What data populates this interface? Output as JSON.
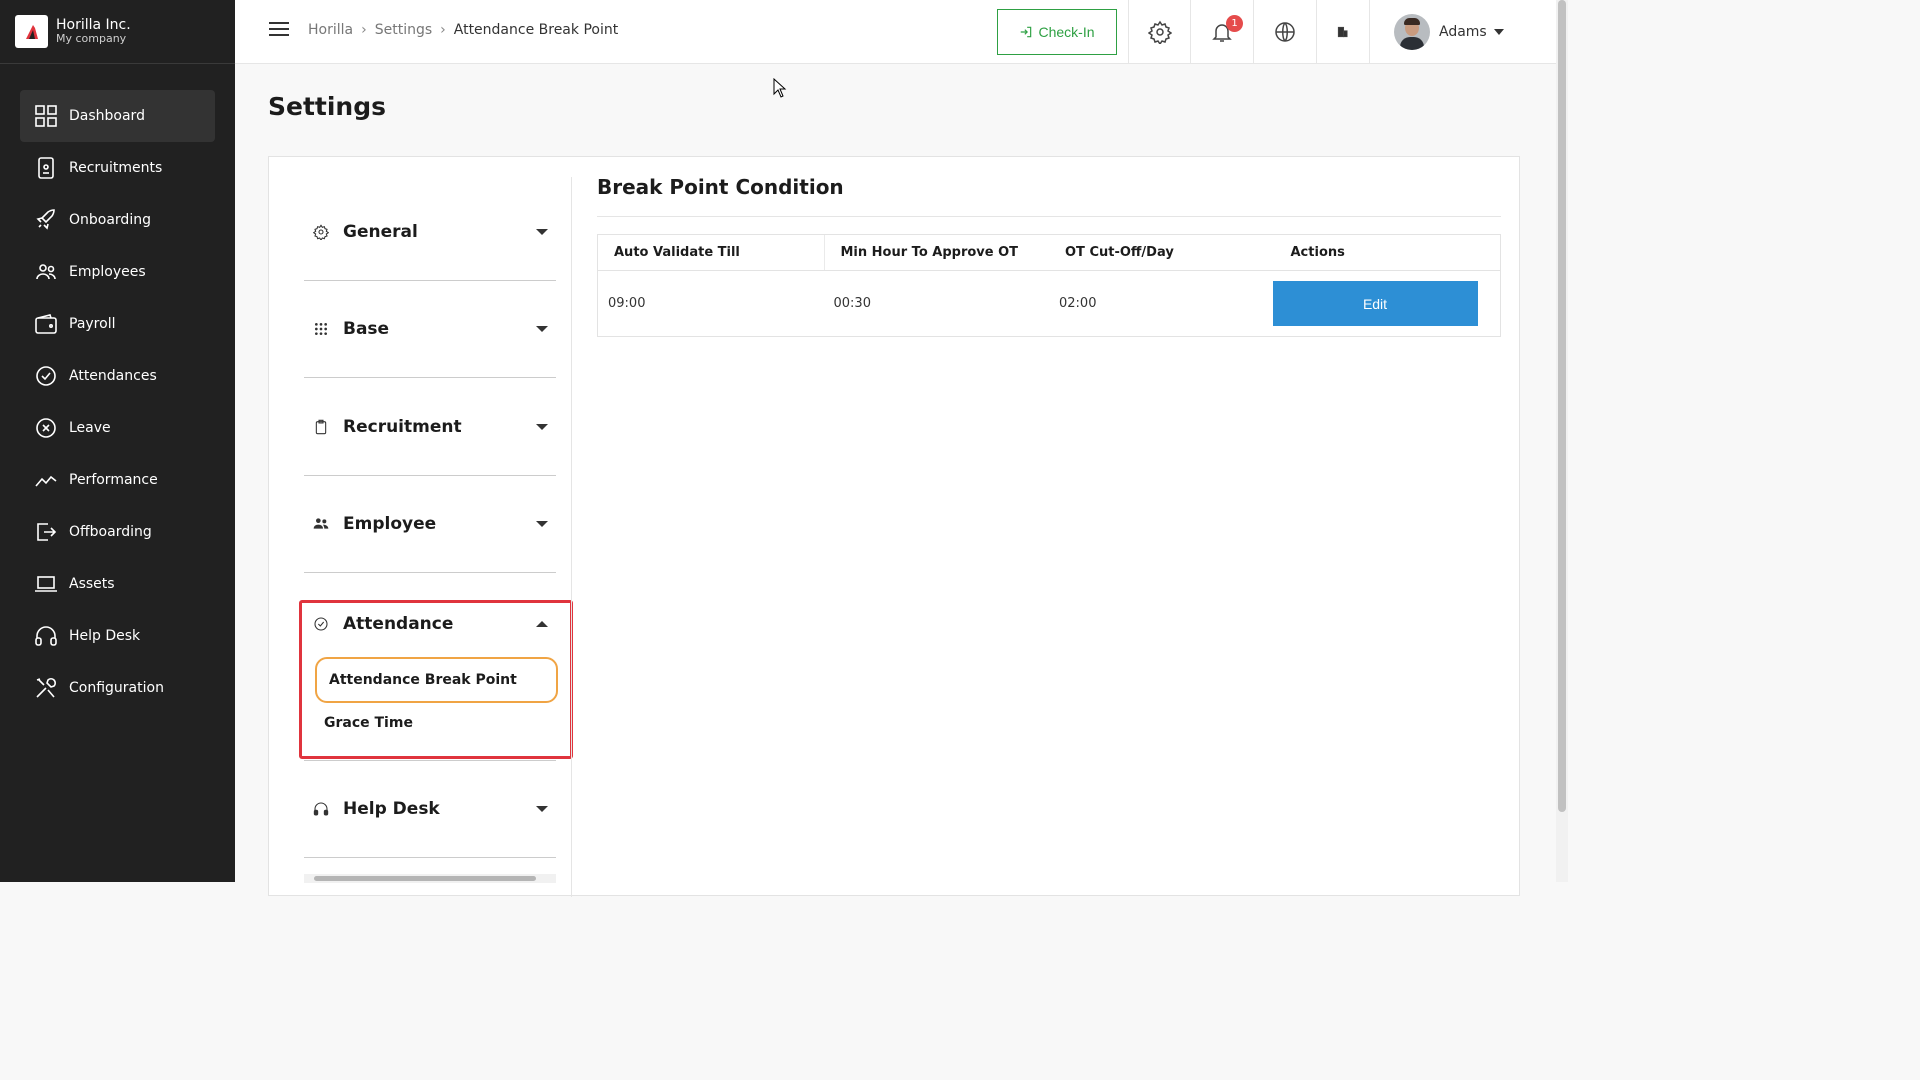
{
  "brand": {
    "name": "Horilla Inc.",
    "subtitle": "My company"
  },
  "sidebar": {
    "items": [
      {
        "label": "Dashboard",
        "icon": "dashboard-icon",
        "active": true
      },
      {
        "label": "Recruitments",
        "icon": "recruitment-icon"
      },
      {
        "label": "Onboarding",
        "icon": "rocket-icon"
      },
      {
        "label": "Employees",
        "icon": "people-icon"
      },
      {
        "label": "Payroll",
        "icon": "wallet-icon"
      },
      {
        "label": "Attendances",
        "icon": "check-circle-icon"
      },
      {
        "label": "Leave",
        "icon": "x-circle-icon"
      },
      {
        "label": "Performance",
        "icon": "trend-icon"
      },
      {
        "label": "Offboarding",
        "icon": "exit-icon"
      },
      {
        "label": "Assets",
        "icon": "laptop-icon"
      },
      {
        "label": "Help Desk",
        "icon": "headset-icon"
      },
      {
        "label": "Configuration",
        "icon": "tools-icon"
      }
    ]
  },
  "header": {
    "breadcrumb": [
      "Horilla",
      "Settings",
      "Attendance Break Point"
    ],
    "checkin_label": "Check-In",
    "notification_count": "1",
    "user_name": "Adams"
  },
  "page": {
    "title": "Settings"
  },
  "settings_menu": {
    "sections": [
      {
        "label": "General",
        "icon": "gear-icon",
        "expanded": false
      },
      {
        "label": "Base",
        "icon": "grid-dots-icon",
        "expanded": false
      },
      {
        "label": "Recruitment",
        "icon": "clipboard-icon",
        "expanded": false
      },
      {
        "label": "Employee",
        "icon": "people-icon",
        "expanded": false
      },
      {
        "label": "Attendance",
        "icon": "check-circle-icon",
        "expanded": true
      },
      {
        "label": "Help Desk",
        "icon": "headphones-icon",
        "expanded": false
      }
    ],
    "attendance_items": [
      "Attendance Break Point",
      "Grace Time"
    ],
    "active_item": "Attendance Break Point"
  },
  "content": {
    "title": "Break Point Condition",
    "columns": [
      "Auto Validate Till",
      "Min Hour To Approve OT",
      "OT Cut-Off/Day",
      "Actions"
    ],
    "rows": [
      {
        "auto_validate_till": "09:00",
        "min_hour_ot": "00:30",
        "ot_cutoff": "02:00",
        "action": "Edit"
      }
    ]
  },
  "colors": {
    "sidebar_bg": "#212121",
    "accent_green": "#2ea043",
    "edit_button": "#2d8fd5",
    "highlight_red": "#e0343d",
    "highlight_orange": "#f0a444"
  }
}
